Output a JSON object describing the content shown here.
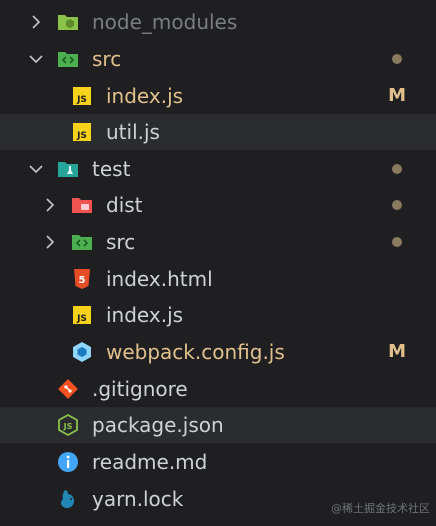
{
  "explorer": {
    "items": [
      {
        "label": "node_modules",
        "icon": "node-modules-folder-icon",
        "chevron": "right",
        "muted": true
      },
      {
        "label": "src",
        "icon": "src-folder-icon",
        "chevron": "down",
        "dot": true,
        "modified": true
      },
      {
        "label": "index.js",
        "icon": "js-file-icon",
        "badge": "M",
        "modified": true
      },
      {
        "label": "util.js",
        "icon": "js-file-icon"
      },
      {
        "label": "test",
        "icon": "test-folder-icon",
        "chevron": "down",
        "dot": true
      },
      {
        "label": "dist",
        "icon": "dist-folder-icon",
        "chevron": "right",
        "dot": true
      },
      {
        "label": "src",
        "icon": "src-folder-icon",
        "chevron": "right",
        "dot": true
      },
      {
        "label": "index.html",
        "icon": "html-file-icon"
      },
      {
        "label": "index.js",
        "icon": "js-file-icon"
      },
      {
        "label": "webpack.config.js",
        "icon": "webpack-file-icon",
        "badge": "M",
        "modified": true
      },
      {
        "label": ".gitignore",
        "icon": "git-icon"
      },
      {
        "label": "package.json",
        "icon": "nodejs-file-icon"
      },
      {
        "label": "readme.md",
        "icon": "info-icon"
      },
      {
        "label": "yarn.lock",
        "icon": "yarn-icon"
      }
    ]
  },
  "watermark": "@稀土掘金技术社区",
  "colors": {
    "background": "#1f1f22",
    "row_highlight": "#2b2c30",
    "modified": "#e2c08d",
    "muted": "#7b7d82",
    "dot": "#8a7a5f"
  }
}
